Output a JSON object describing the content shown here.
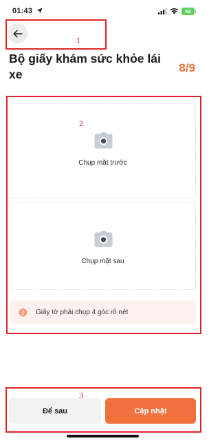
{
  "status_bar": {
    "time": "01:43",
    "battery": "62",
    "icons": [
      "location-arrow-icon",
      "signal-icon",
      "wifi-icon",
      "battery-icon"
    ]
  },
  "annotations": [
    "1",
    "2",
    "3"
  ],
  "header": {
    "back_icon": "arrow-left-icon",
    "title": "Bộ giấy khám sức khỏe lái xe",
    "step": "8/9"
  },
  "capture": {
    "front_label": "Chụp mặt trước",
    "back_label": "Chụp mặt sau",
    "icon": "camera-icon"
  },
  "notice": {
    "icon": "alert-icon",
    "text": "Giấy tờ phải chụp 4 góc rõ nét"
  },
  "footer": {
    "later_label": "Để sau",
    "update_label": "Cập nhật"
  },
  "colors": {
    "accent": "#f0713e",
    "annotation": "#e0242a",
    "notice_bg": "#fdf1ef",
    "battery": "#5fcf5e"
  }
}
